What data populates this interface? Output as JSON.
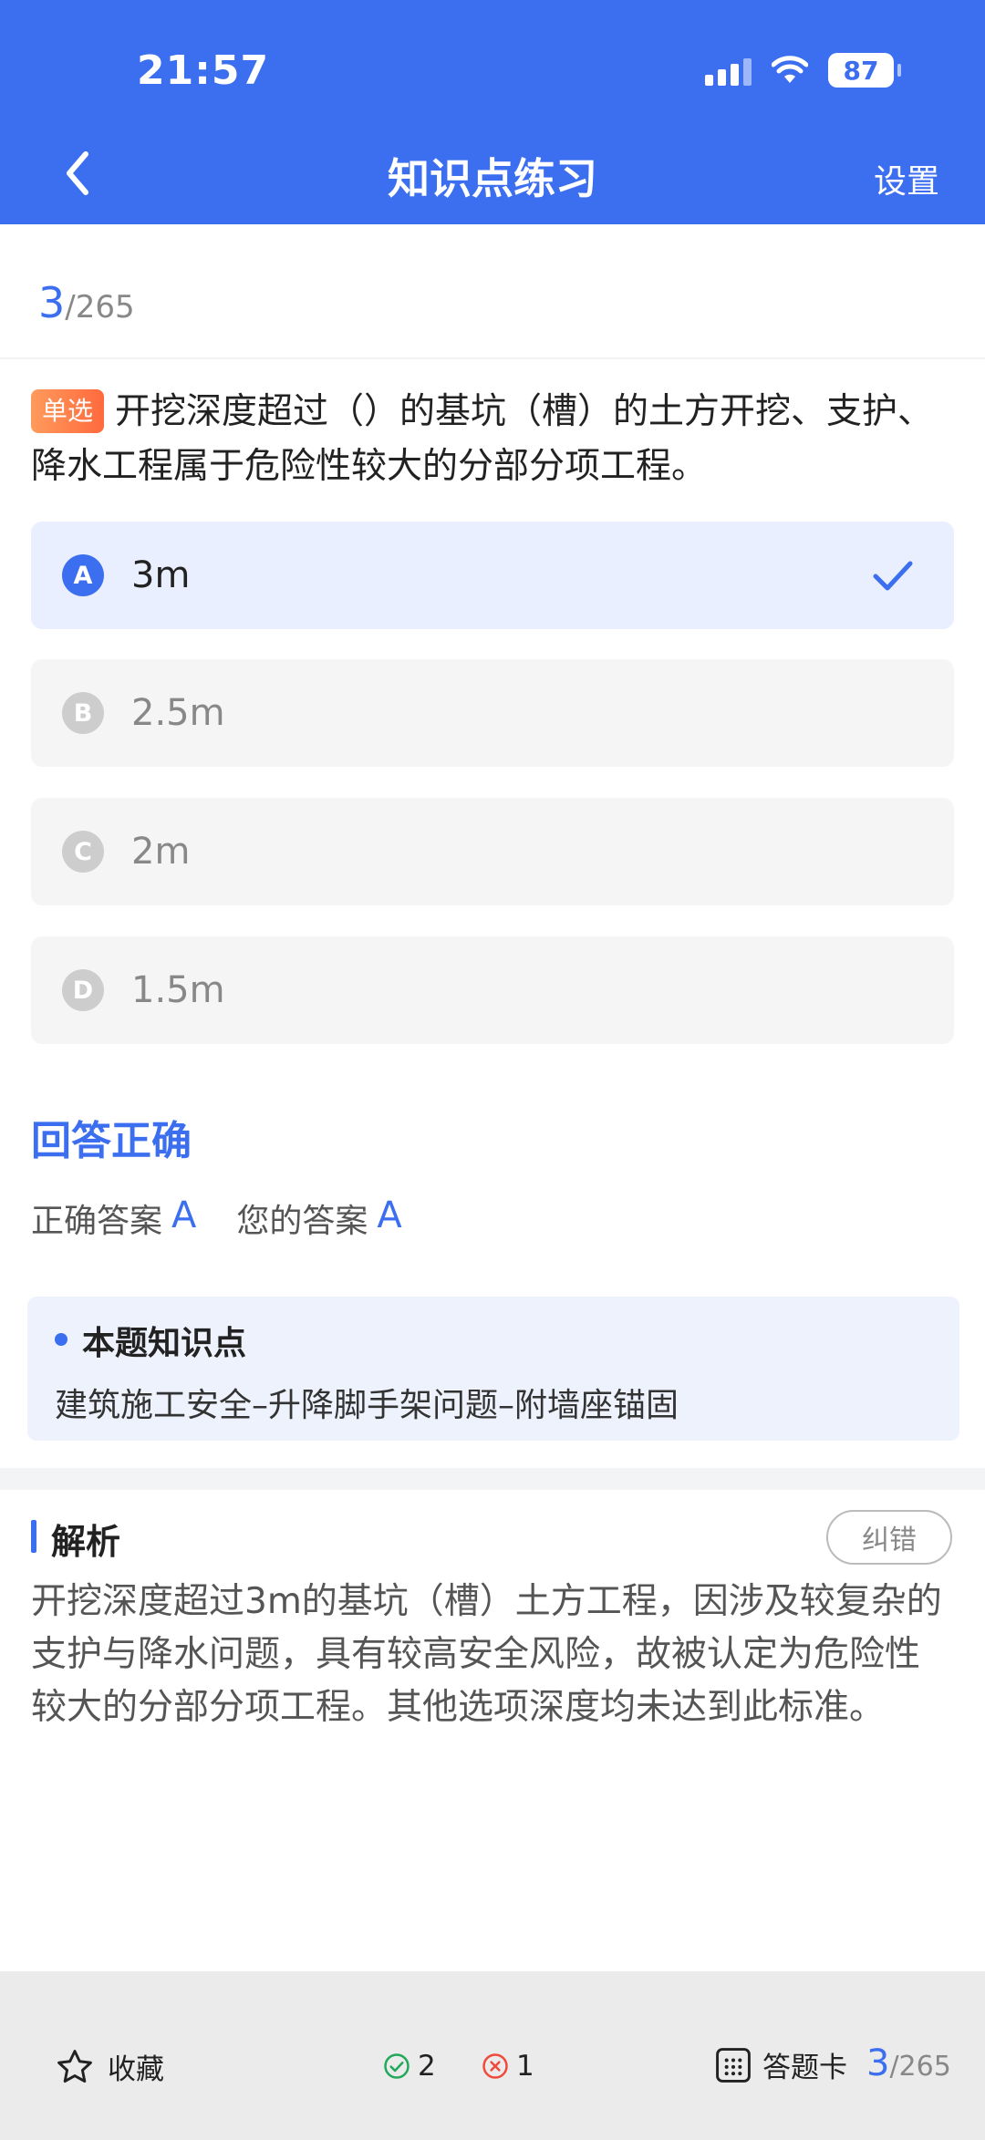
{
  "status_bar": {
    "time": "21:57",
    "battery": "87"
  },
  "nav": {
    "title": "知识点练习",
    "settings": "设置"
  },
  "progress": {
    "current": "3",
    "total": "/265"
  },
  "question": {
    "tag": "单选",
    "text": "开挖深度超过（）的基坑（槽）的土方开挖、支护、降水工程属于危险性较大的分部分项工程。"
  },
  "options": [
    {
      "letter": "A",
      "text": "3m",
      "selected": true
    },
    {
      "letter": "B",
      "text": "2.5m",
      "selected": false
    },
    {
      "letter": "C",
      "text": "2m",
      "selected": false
    },
    {
      "letter": "D",
      "text": "1.5m",
      "selected": false
    }
  ],
  "result": {
    "title": "回答正确",
    "correct_label": "正确答案",
    "correct_value": "A",
    "yours_label": "您的答案",
    "yours_value": "A"
  },
  "knowledge": {
    "title": "本题知识点",
    "content": "建筑施工安全–升降脚手架问题–附墙座锚固"
  },
  "analysis": {
    "title": "解析",
    "report_button": "纠错",
    "text": "开挖深度超过3m的基坑（槽）土方工程，因涉及较复杂的支护与降水问题，具有较高安全风险，故被认定为危险性较大的分部分项工程。其他选项深度均未达到此标准。"
  },
  "bottom_bar": {
    "favorite_label": "收藏",
    "correct_count": "2",
    "wrong_count": "1",
    "answer_card_label": "答题卡",
    "current": "3",
    "total": "/265"
  },
  "colors": {
    "primary": "#3c6ef0",
    "correct": "#22a85a",
    "wrong": "#f04a3c",
    "tag": "#ff7a45"
  },
  "icons": [
    "back-arrow-icon",
    "signal-icon",
    "wifi-icon",
    "battery-icon",
    "check-icon",
    "star-icon",
    "check-circle-icon",
    "x-circle-icon",
    "grid-icon"
  ]
}
